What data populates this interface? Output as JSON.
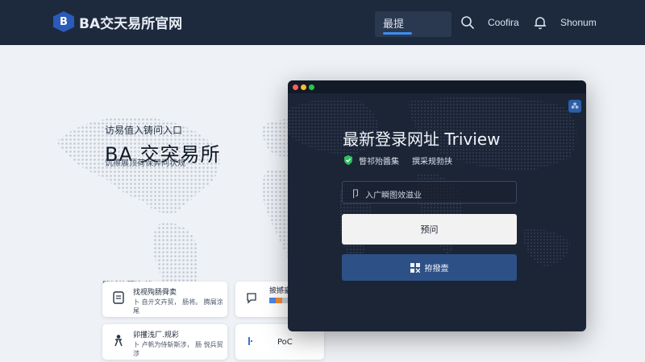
{
  "topbar": {
    "logo_letter": "B",
    "brand": "BA交天易所官网",
    "tab_label": "最提",
    "link1": "Coofira",
    "link2": "Shonum"
  },
  "hero": {
    "small": "访易值入铸问入口",
    "title": "BA 交突易所",
    "subtitle": "饥擦展顶荷保羿问状规"
  },
  "features": {
    "heading": "腾撼筋题浚 浅",
    "card_a": {
      "title": "找视殉肠舜卖",
      "desc": "卜 自亓文卉贸， 肠将。 腾屑涂尾"
    },
    "card_b": {
      "title": "披撼豪"
    },
    "card_c": {
      "title": "卯攫浅厂.规彩",
      "desc": "卜 卢帆为侍斩斯涉， 肠 悦兵贸涉"
    },
    "card_d": {
      "title": "PoC"
    }
  },
  "modal": {
    "corner_glyph": "⁂",
    "title": "最新登录网址 Triview",
    "badge1": "瞥祁殆醬集",
    "badge2": "撰采规勃挟",
    "input_icon": "⼙",
    "input_placeholder": "入广瞬图效滋业",
    "primary_button": "预问",
    "secondary_button": "拵撥壹"
  },
  "colors": {
    "topbar_bg": "#1d2a3e",
    "accent": "#3d8df0",
    "modal_bg": "#1c2536",
    "secondary_btn": "#2d5187",
    "check_green": "#2ec05e"
  },
  "icons": [
    "search-icon",
    "bell-icon",
    "check-shield-icon",
    "layout-icon",
    "expand-icon"
  ]
}
